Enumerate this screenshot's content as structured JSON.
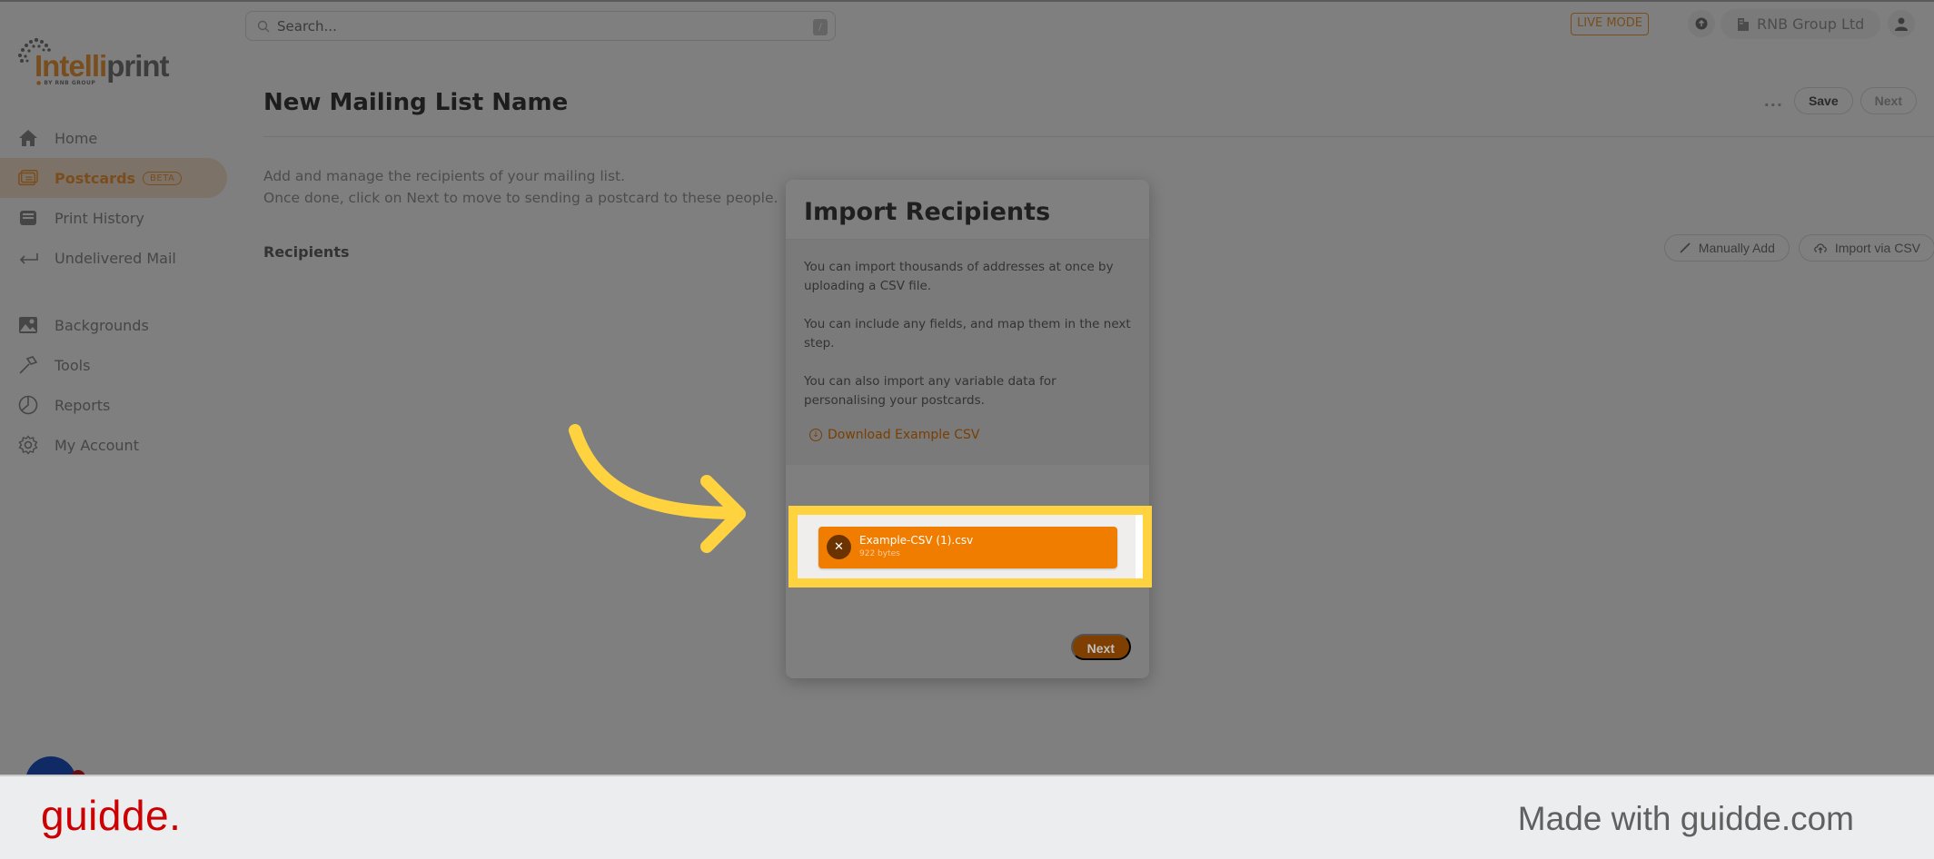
{
  "app": {
    "brand": {
      "name_part1": "Intelli",
      "name_part2": "print",
      "tagline": "BY RNB GROUP"
    },
    "search": {
      "placeholder": "Search...",
      "shortcut": "/"
    },
    "header": {
      "mode_badge": "LIVE MODE",
      "organization": "RNB Group Ltd"
    },
    "sidebar": {
      "items": [
        {
          "label": "Home",
          "icon": "home-icon",
          "active": false
        },
        {
          "label": "Postcards",
          "icon": "postcard-icon",
          "active": true,
          "badge": "BETA"
        },
        {
          "label": "Print History",
          "icon": "inbox-tray-icon",
          "active": false
        },
        {
          "label": "Undelivered Mail",
          "icon": "return-arrow-icon",
          "active": false
        },
        {
          "label": "Backgrounds",
          "icon": "image-icon",
          "active": false
        },
        {
          "label": "Tools",
          "icon": "hammer-icon",
          "active": false
        },
        {
          "label": "Reports",
          "icon": "pie-chart-icon",
          "active": false
        },
        {
          "label": "My Account",
          "icon": "gear-icon",
          "active": false
        }
      ]
    },
    "page": {
      "title": "New Mailing List Name",
      "more_label": "...",
      "save_label": "Save",
      "next_label": "Next",
      "description_line1": "Add and manage the recipients of your mailing list.",
      "description_line2": "Once done, click on Next to move to sending a postcard to these people.",
      "section_title": "Recipients",
      "manual_add_label": "Manually Add",
      "import_csv_label": "Import via CSV"
    }
  },
  "modal": {
    "title": "Import Recipients",
    "paragraphs": [
      "You can import thousands of addresses at once by uploading a CSV file.",
      "You can include any fields, and map them in the next step.",
      "You can also import any variable data for personalising your postcards."
    ],
    "download_label": "Download Example CSV",
    "file": {
      "name": "Example-CSV (1).csv",
      "size": "922 bytes"
    },
    "next_label": "Next"
  },
  "colors": {
    "brand_orange": "#f29b3c",
    "file_chip": "#f07c00",
    "highlight": "#ffd340",
    "guidde_red": "#cc0000"
  },
  "footer": {
    "logo": "guidde.",
    "tagline": "Made with guidde.com"
  }
}
